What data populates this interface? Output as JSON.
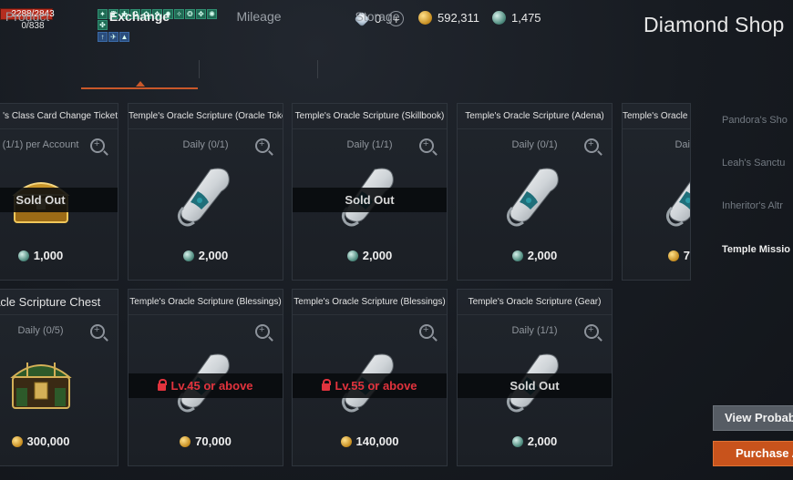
{
  "status": {
    "hp_text": "2288/2843",
    "hp_fraction": 0.805,
    "mp_text": "0/838",
    "buff_icons_top": [
      "buff",
      "buff",
      "buff",
      "buff",
      "buff",
      "buff",
      "buff",
      "buff",
      "buff",
      "buff",
      "buff",
      "buff"
    ],
    "buff_icons_bottom": [
      "buff",
      "buff",
      "buff"
    ]
  },
  "currencies": {
    "diamond": "0",
    "adena": "592,311",
    "gem": "1,475"
  },
  "header": {
    "title": "Diamond Shop"
  },
  "tabs": [
    {
      "label": "Product",
      "active": false
    },
    {
      "label": "Exchange",
      "active": true
    },
    {
      "label": "Mileage",
      "active": false
    },
    {
      "label": "Storage",
      "active": false
    }
  ],
  "items": [
    {
      "title": "'s Class Card Change Ticket",
      "limit": "(1/1) per Account",
      "art": "gold-chest",
      "status": "Sold Out",
      "status_type": "soldout",
      "currency": "gem",
      "price": "1,000"
    },
    {
      "title": "Temple's Oracle Scripture (Oracle Token)",
      "limit": "Daily (0/1)",
      "art": "scroll",
      "status": "",
      "status_type": "",
      "currency": "gem",
      "price": "2,000"
    },
    {
      "title": "Temple's Oracle Scripture (Skillbook)",
      "limit": "Daily (1/1)",
      "art": "scroll",
      "status": "Sold Out",
      "status_type": "soldout",
      "currency": "gem",
      "price": "2,000"
    },
    {
      "title": "Temple's Oracle Scripture (Adena)",
      "limit": "Daily (0/1)",
      "art": "scroll",
      "status": "",
      "status_type": "",
      "currency": "gem",
      "price": "2,000"
    },
    {
      "title": "Temple's Oracle",
      "limit": "Dai",
      "art": "scroll",
      "status": "",
      "status_type": "",
      "currency": "gold",
      "price": "7"
    },
    {
      "title": "Oracle Scripture Chest",
      "limit": "Daily (0/5)",
      "art": "green-chest",
      "status": "",
      "status_type": "",
      "currency": "gold",
      "price": "300,000"
    },
    {
      "title": "Temple's Oracle Scripture (Blessings)",
      "limit": "",
      "art": "scroll",
      "status": "Lv.45 or above",
      "status_type": "locked",
      "currency": "gold",
      "price": "70,000"
    },
    {
      "title": "Temple's Oracle Scripture (Blessings)",
      "limit": "",
      "art": "scroll",
      "status": "Lv.55 or above",
      "status_type": "locked",
      "currency": "gold",
      "price": "140,000"
    },
    {
      "title": "Temple's Oracle Scripture (Gear)",
      "limit": "Daily (1/1)",
      "art": "scroll",
      "status": "Sold Out",
      "status_type": "soldout",
      "currency": "gem",
      "price": "2,000"
    }
  ],
  "side_menu": [
    {
      "label": "Pandora's Sho",
      "active": false
    },
    {
      "label": "Leah's Sanctu",
      "active": false
    },
    {
      "label": "Inheritor's Altr",
      "active": false
    },
    {
      "label": "Temple Missio",
      "active": true
    }
  ],
  "buttons": {
    "view": "View Probab",
    "purchase": "Purchase A"
  },
  "colors": {
    "accent": "#c9582a",
    "purchase": "#c8531c",
    "locked": "#e2333d"
  }
}
